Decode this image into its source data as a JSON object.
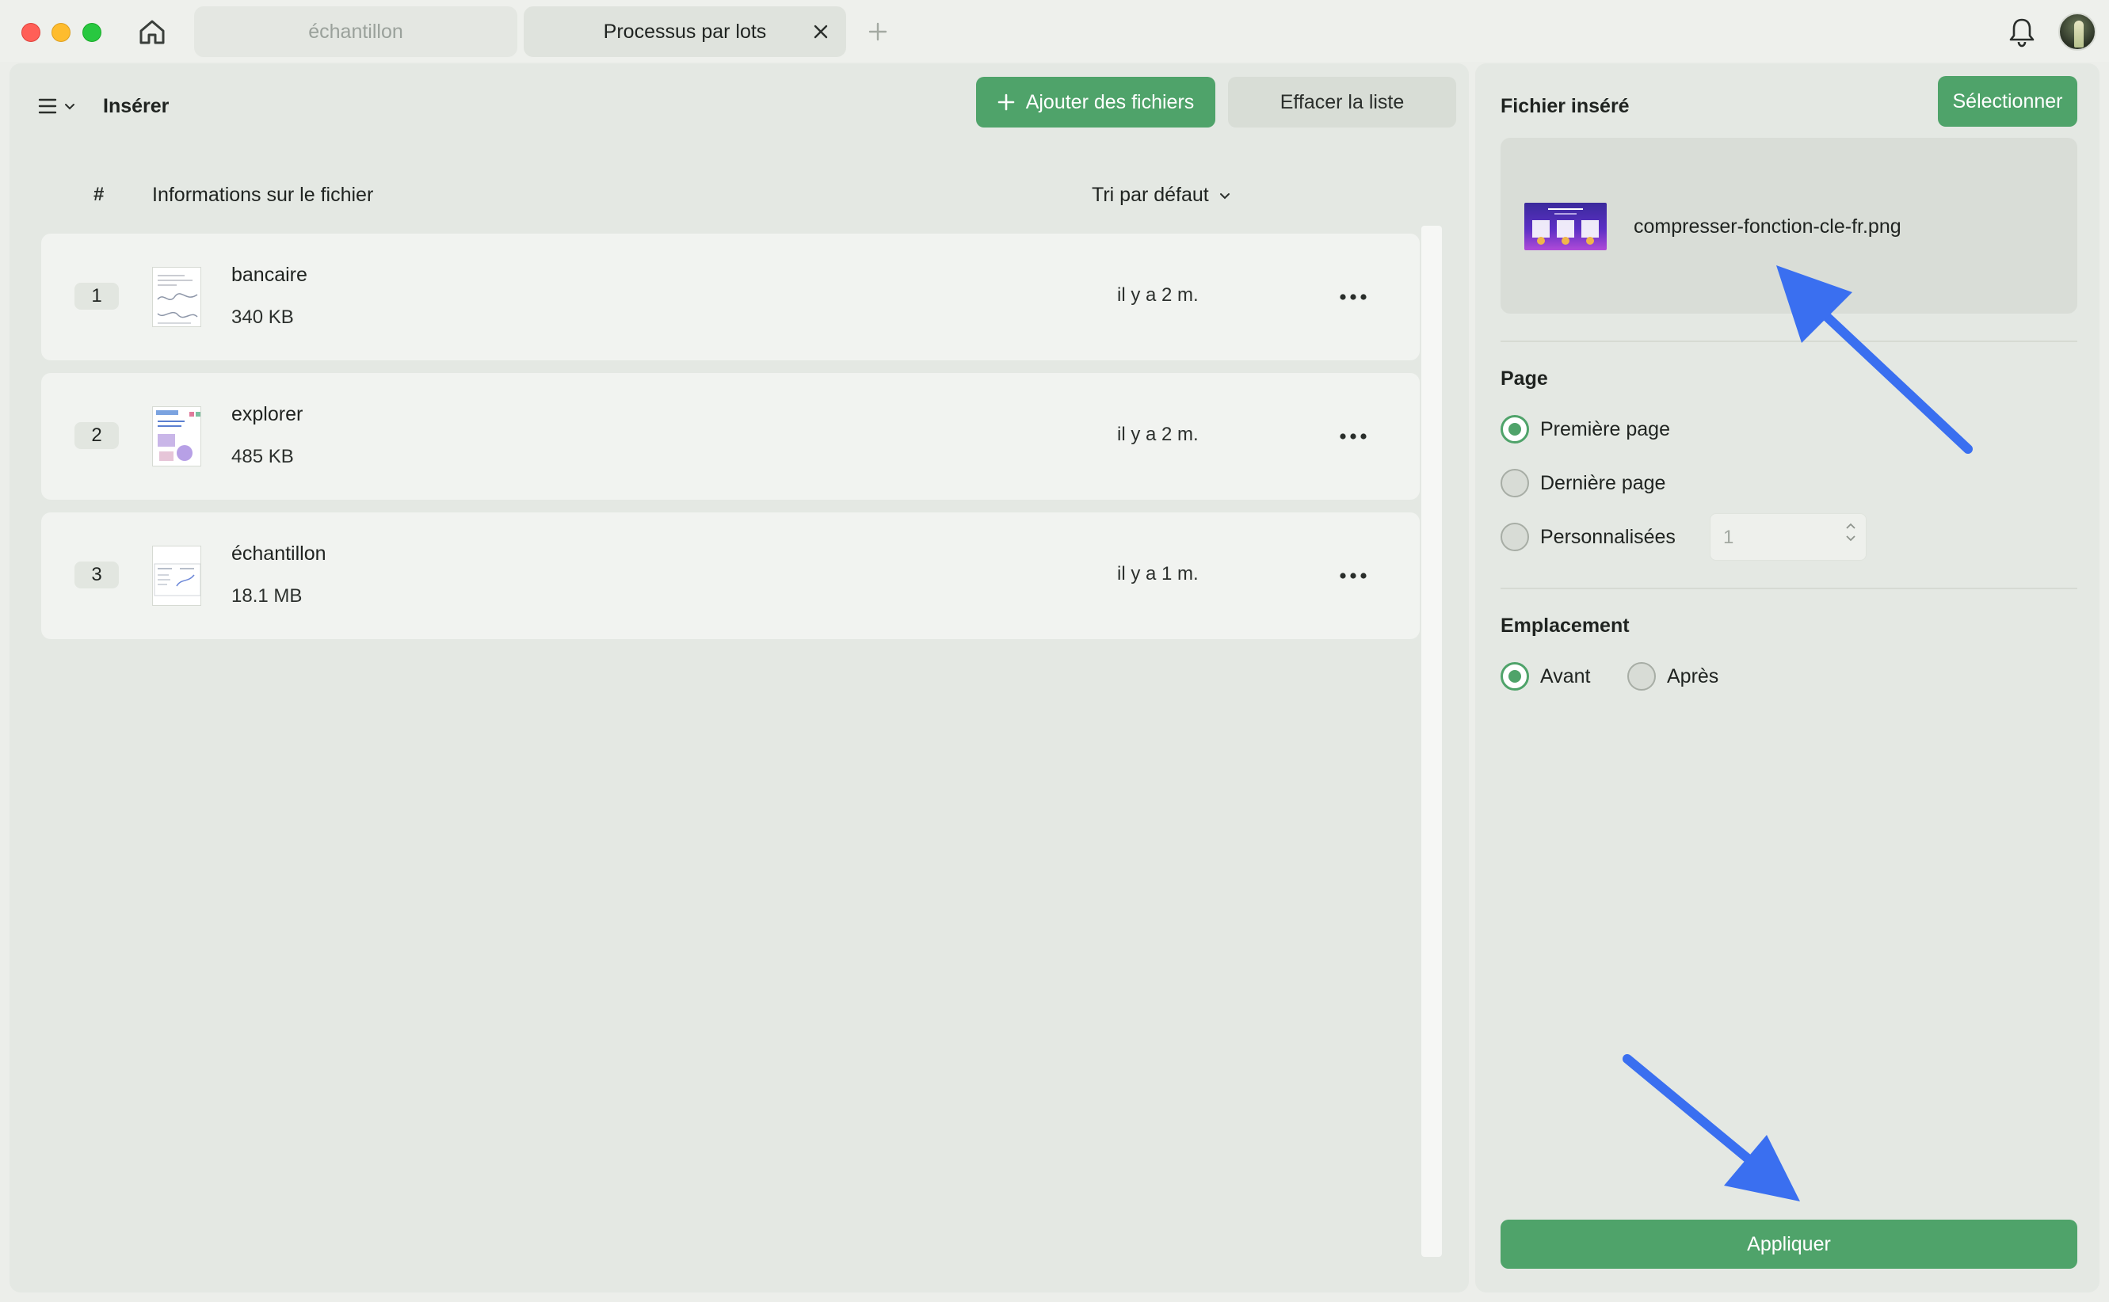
{
  "window": {
    "tabs": [
      {
        "label": "échantillon",
        "active": false
      },
      {
        "label": "Processus par lots",
        "active": true
      }
    ]
  },
  "left": {
    "title": "Insérer",
    "add_files_label": "Ajouter des fichiers",
    "clear_list_label": "Effacer la liste",
    "columns": {
      "hash": "#",
      "info": "Informations sur le fichier",
      "sort": "Tri par défaut"
    },
    "files": [
      {
        "num": "1",
        "name": "bancaire",
        "size": "340 KB",
        "time": "il y a 2 m."
      },
      {
        "num": "2",
        "name": "explorer",
        "size": "485 KB",
        "time": "il y a 2 m."
      },
      {
        "num": "3",
        "name": "échantillon",
        "size": "18.1 MB",
        "time": "il y a 1 m."
      }
    ]
  },
  "right": {
    "title": "Fichier inséré",
    "select_label": "Sélectionner",
    "inserted_file": "compresser-fonction-cle-fr.png",
    "page_section": "Page",
    "page_options": {
      "first": "Première page",
      "last": "Dernière page",
      "custom": "Personnalisées"
    },
    "selected_page_option": "first",
    "custom_page_value": "1",
    "placement_section": "Emplacement",
    "placement_options": {
      "before": "Avant",
      "after": "Après"
    },
    "selected_placement": "before",
    "apply_label": "Appliquer"
  },
  "colors": {
    "accent": "#4fa36a",
    "annotation_arrow": "#3a6ff0"
  },
  "icons": [
    "home-icon",
    "close-icon",
    "plus-icon",
    "bell-icon",
    "menu-icon",
    "chevron-down-icon",
    "more-icon"
  ]
}
